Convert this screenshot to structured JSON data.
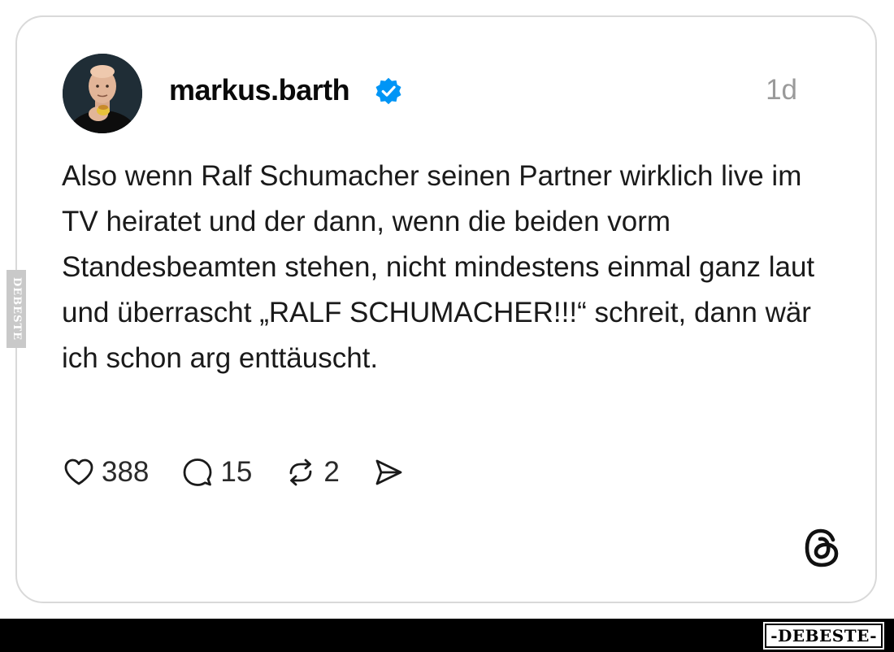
{
  "post": {
    "author": {
      "username": "markus.barth",
      "verified": true
    },
    "timestamp": "1d",
    "text": "Also wenn Ralf Schumacher seinen Partner wirklich live im TV heiratet und der dann, wenn die beiden vorm Standesbeamten stehen, nicht mindestens einmal ganz laut und überrascht „RALF SCHUMACHER!!!“ schreit, dann wär ich schon arg enttäuscht.",
    "actions": {
      "likes": "388",
      "comments": "15",
      "reposts": "2"
    }
  },
  "icons": {
    "like": "heart-icon",
    "comment": "comment-bubble-icon",
    "repost": "repost-icon",
    "share": "share-icon",
    "platform": "threads-logo-icon",
    "verified": "verified-badge-icon"
  },
  "colors": {
    "verified_badge": "#0095f6",
    "timestamp": "#9a9a9a",
    "card_border": "#d9d9d9",
    "bottom_bar": "#000000"
  },
  "watermark": {
    "side": "DEBESTE",
    "bottom": "-DEBESTE-"
  }
}
